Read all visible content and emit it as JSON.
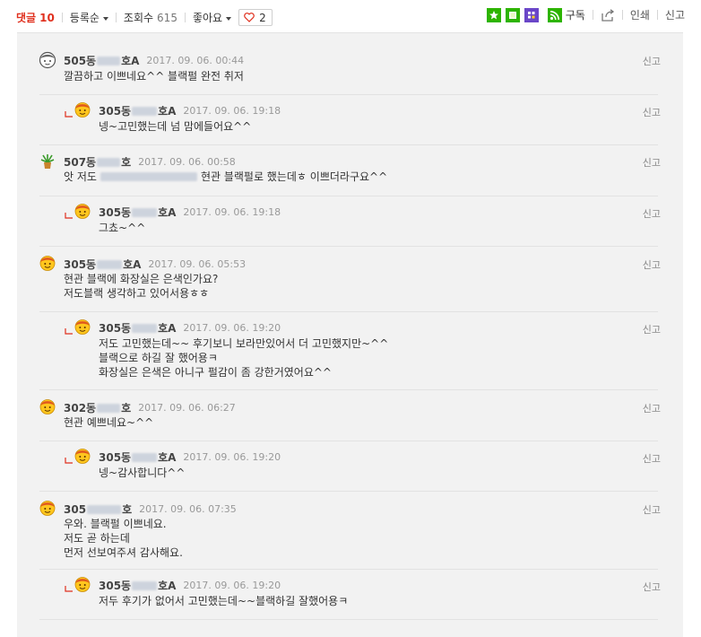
{
  "toolbar": {
    "comments_label": "댓글",
    "comments_count": "10",
    "sort_label": "등록순",
    "views_label": "조회수",
    "views_count": "615",
    "like_menu_label": "좋아요",
    "like_count": "2",
    "subscribe_label": "구독",
    "print_label": "인쇄",
    "report_label": "신고"
  },
  "colors": {
    "accent_red": "#e0301e",
    "green_icon": "#2db400",
    "purple_icon": "#6a46c8",
    "panel_bg": "#f2f2f2"
  },
  "comments": [
    {
      "author_prefix": "505동",
      "author_suffix": "호A",
      "date": "2017. 09. 06.  00:44",
      "avatar": "face-icon",
      "report": "신고",
      "lines": [
        "깔끔하고 이쁘네요^^ 블랙펄 완전 취저"
      ]
    },
    {
      "author_prefix": "305동",
      "author_suffix": "호A",
      "date": "2017. 09. 06.  19:18",
      "avatar": "smiley-icon",
      "report": "신고",
      "reply": true,
      "lines": [
        "넹~고민했는데 넘 맘에들어요^^"
      ]
    },
    {
      "author_prefix": "507동",
      "author_suffix": "호",
      "date": "2017. 09. 06.  00:58",
      "avatar": "plant-icon",
      "report": "신고",
      "lines_prefix": "앗 저도",
      "lines_suffix": "현관 블랙펄로 했는데ㅎ 이쁘더라구요^^"
    },
    {
      "author_prefix": "305동",
      "author_suffix": "호A",
      "date": "2017. 09. 06.  19:18",
      "avatar": "smiley-icon",
      "report": "신고",
      "reply": true,
      "lines": [
        "그쵸~^^"
      ]
    },
    {
      "author_prefix": "305동",
      "author_suffix": "호A",
      "date": "2017. 09. 06.  05:53",
      "avatar": "smiley-icon",
      "report": "신고",
      "lines": [
        "현관 블랙에 화장실은 은색인가요?",
        "저도블랙 생각하고 있어서용ㅎㅎ"
      ]
    },
    {
      "author_prefix": "305동",
      "author_suffix": "호A",
      "date": "2017. 09. 06.  19:20",
      "avatar": "smiley-icon",
      "report": "신고",
      "reply": true,
      "lines": [
        "저도 고민했는데~~ 후기보니 보라만있어서 더 고민했지만~^^",
        "블랙으로 하길 잘 했어용ㅋ",
        "화장실은 은색은 아니구 펄감이 좀 강한거였어요^^"
      ]
    },
    {
      "author_prefix": "302동",
      "author_suffix": "호",
      "date": "2017. 09. 06.  06:27",
      "avatar": "smiley-icon",
      "report": "신고",
      "lines": [
        "현관 예쁘네요~^^"
      ]
    },
    {
      "author_prefix": "305동",
      "author_suffix": "호A",
      "date": "2017. 09. 06.  19:20",
      "avatar": "smiley-icon",
      "report": "신고",
      "reply": true,
      "lines": [
        "넹~감사합니다^^"
      ]
    },
    {
      "author_prefix": "305",
      "author_suffix": "호",
      "date": "2017. 09. 06.  07:35",
      "avatar": "smiley-icon",
      "report": "신고",
      "lines": [
        "우와. 블랙펄 이쁘네요.",
        "저도 곧 하는데",
        "먼저 선보여주셔 감사해요."
      ]
    },
    {
      "author_prefix": "305동",
      "author_suffix": "호A",
      "date": "2017. 09. 06.  19:20",
      "avatar": "smiley-icon",
      "report": "신고",
      "reply": true,
      "lines": [
        "저두 후기가 없어서 고민했는데~~블랙하길 잘했어용ㅋ"
      ]
    }
  ]
}
